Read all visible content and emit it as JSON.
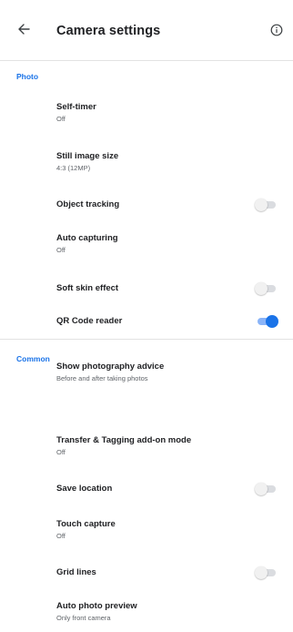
{
  "header": {
    "title": "Camera settings",
    "back_icon": "arrow-left-icon",
    "info_icon": "info-icon"
  },
  "colors": {
    "accent": "#1a73e8",
    "toggle_on_track": "#8ab4f8",
    "toggle_off_track": "#dadce0"
  },
  "sections": [
    {
      "header": "Photo",
      "items": [
        {
          "title": "Self-timer",
          "summary": "Off"
        },
        {
          "title": "Still image size",
          "summary": "4:3 (12MP)"
        },
        {
          "title": "Object tracking",
          "toggle": false
        },
        {
          "title": "Auto capturing",
          "summary": "Off"
        },
        {
          "title": "Soft skin effect",
          "toggle": false
        },
        {
          "title": "QR Code reader",
          "toggle": true
        }
      ]
    },
    {
      "header": "Common",
      "items": [
        {
          "title": "Show photography advice",
          "summary": "Before and after taking photos"
        },
        {
          "title": "Transfer & Tagging add-on mode",
          "summary": "Off"
        },
        {
          "title": "Save location",
          "toggle": false
        },
        {
          "title": "Touch capture",
          "summary": "Off"
        },
        {
          "title": "Grid lines",
          "toggle": false
        },
        {
          "title": "Auto photo preview",
          "summary": "Only front camera"
        }
      ]
    }
  ]
}
